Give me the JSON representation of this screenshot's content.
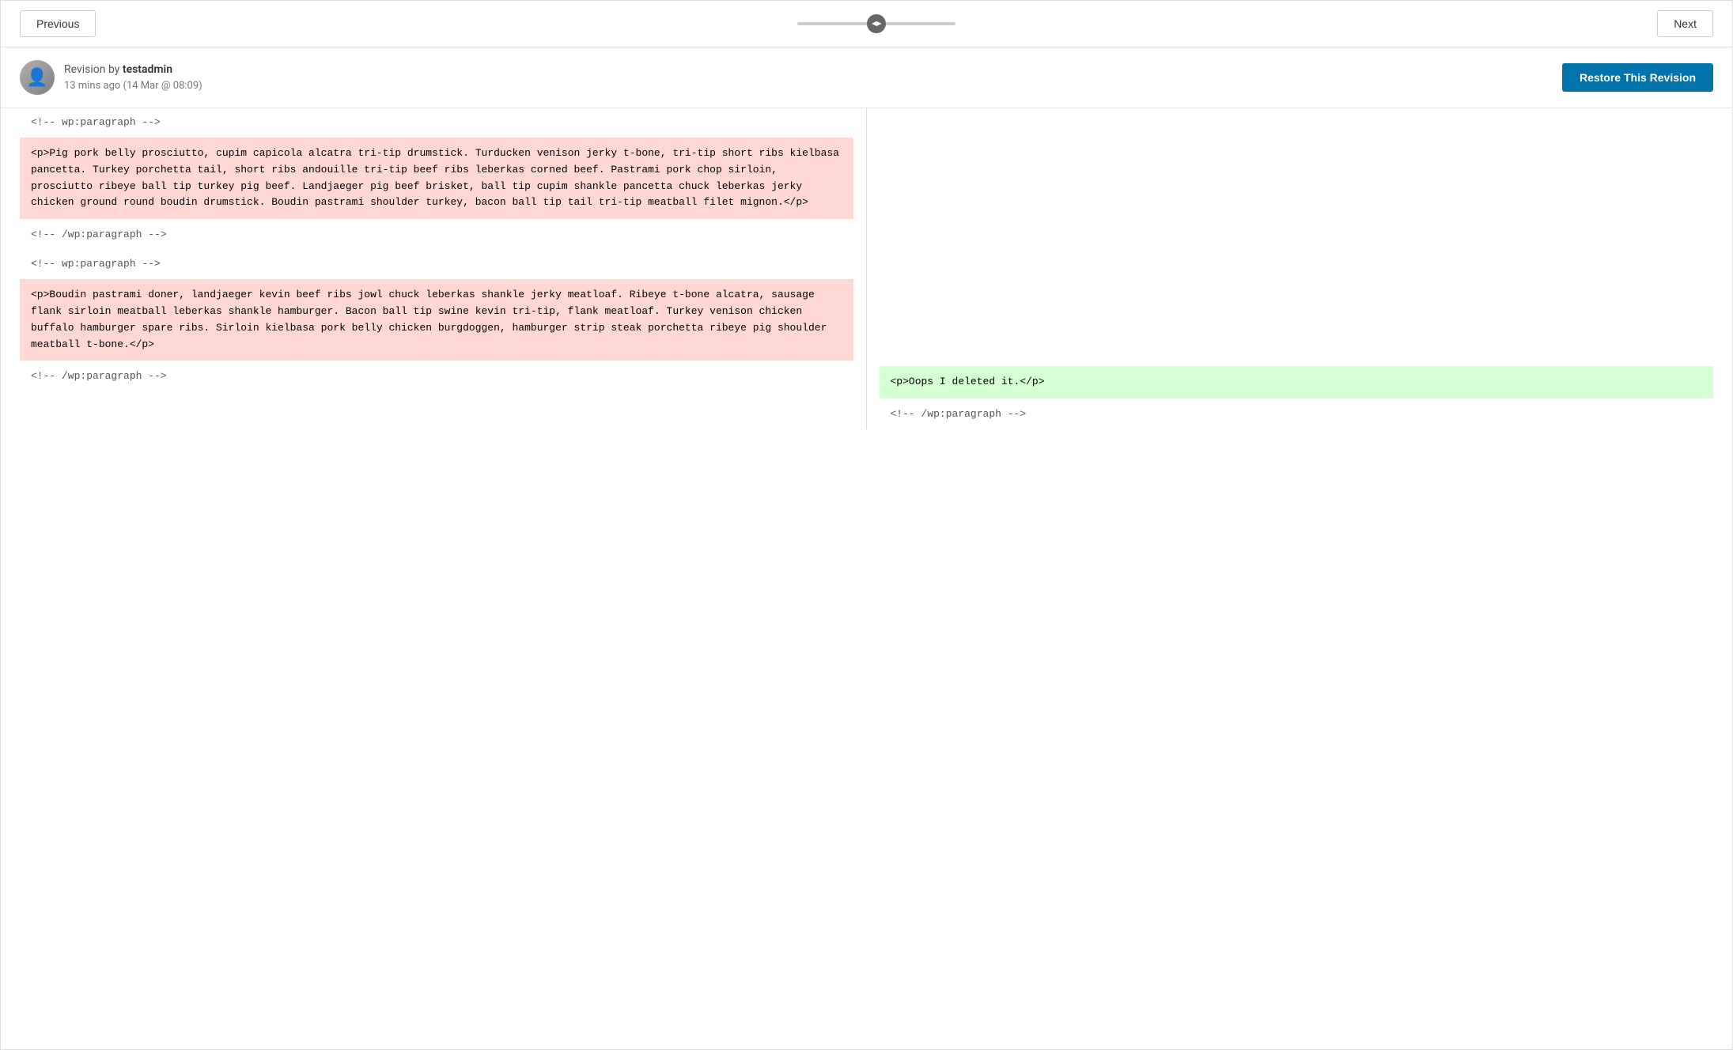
{
  "nav": {
    "prev_label": "Previous",
    "next_label": "Next"
  },
  "revision": {
    "by_prefix": "Revision by ",
    "author": "testadmin",
    "time": "13 mins ago (14 Mar @ 08:09)",
    "restore_label": "Restore This Revision"
  },
  "diff": {
    "left_blocks": [
      {
        "type": "comment",
        "text": "<!-- wp:paragraph -->"
      },
      {
        "type": "deleted",
        "text": "<p>Pig pork belly prosciutto, cupim capicola alcatra tri-tip drumstick. Turducken venison jerky t-bone, tri-tip short ribs kielbasa pancetta. Turkey porchetta tail, short ribs andouille tri-tip beef ribs leberkas corned beef. Pastrami pork chop sirloin, prosciutto ribeye ball tip turkey pig beef. Landjaeger pig beef brisket, ball tip cupim shankle pancetta chuck leberkas jerky chicken ground round boudin drumstick. Boudin pastrami shoulder turkey, bacon ball tip tail tri-tip meatball filet mignon.</p>"
      },
      {
        "type": "comment",
        "text": "<!-- /wp:paragraph -->"
      },
      {
        "type": "comment",
        "text": "<!-- wp:paragraph -->"
      },
      {
        "type": "deleted",
        "text": "<p>Boudin pastrami doner, landjaeger kevin beef ribs jowl chuck leberkas shankle jerky meatloaf. Ribeye t-bone alcatra, sausage flank sirloin meatball leberkas shankle hamburger. Bacon ball tip swine kevin tri-tip, flank meatloaf. Turkey venison chicken buffalo hamburger spare ribs. Sirloin kielbasa pork belly chicken burgdoggen, hamburger strip steak porchetta ribeye pig shoulder meatball t-bone.</p>"
      },
      {
        "type": "comment",
        "text": "<!-- /wp:paragraph -->"
      }
    ],
    "right_blocks": [
      {
        "type": "empty",
        "text": ""
      },
      {
        "type": "empty",
        "text": ""
      },
      {
        "type": "empty",
        "text": ""
      },
      {
        "type": "empty",
        "text": ""
      },
      {
        "type": "added",
        "text": "<p>Oops I deleted it.</p>"
      },
      {
        "type": "comment",
        "text": "<!-- /wp:paragraph -->"
      }
    ]
  }
}
